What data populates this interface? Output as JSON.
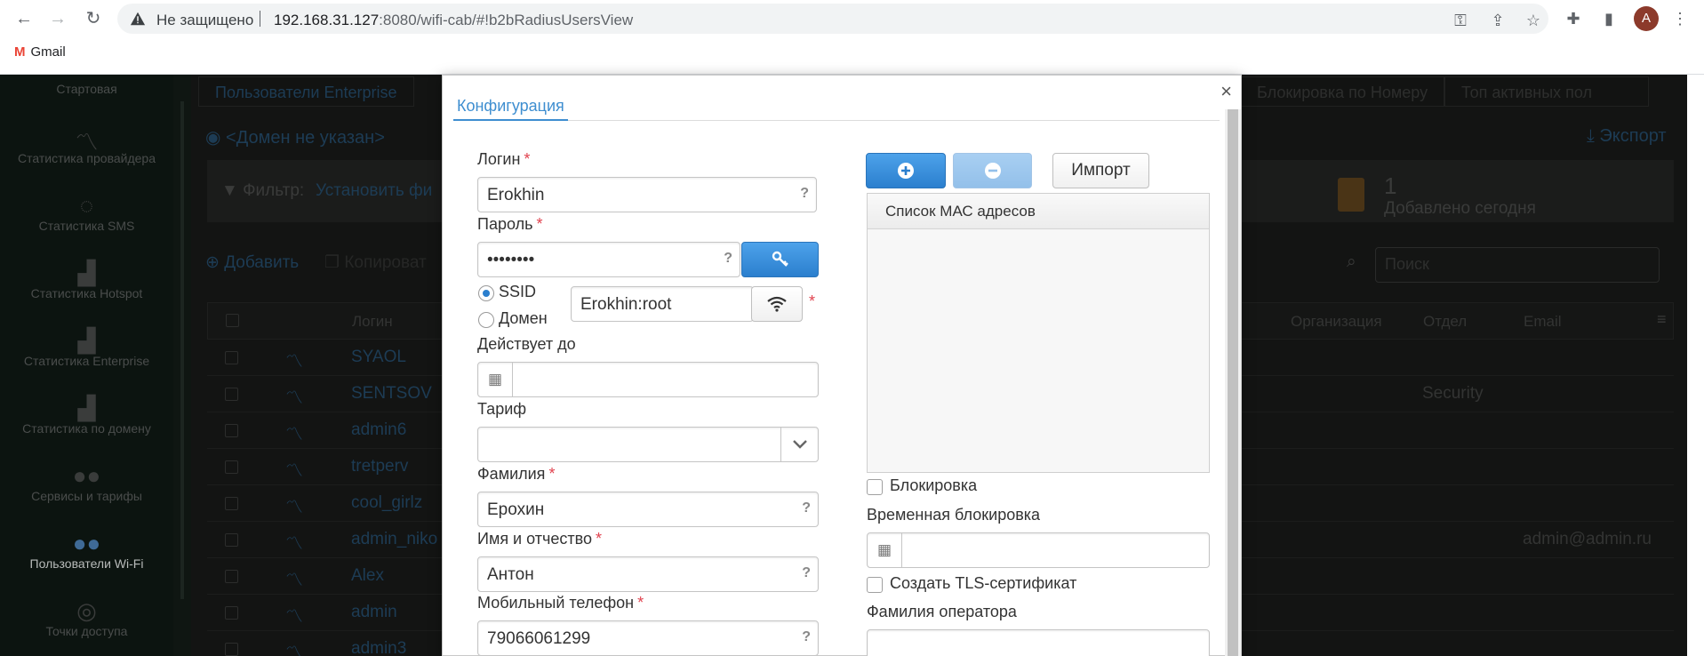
{
  "browser": {
    "security_label": "Не защищено",
    "url_host": "192.168.31.127",
    "url_rest": ":8080/wifi-cab/#!b2bRadiusUsersView",
    "bookmark_gmail": "Gmail",
    "avatar_letter": "A"
  },
  "sidebar": {
    "items": [
      {
        "label": "Стартовая",
        "icon": "home-icon"
      },
      {
        "label": "Статистика провайдера",
        "icon": "chart-line-icon"
      },
      {
        "label": "Статистика SMS",
        "icon": "comment-icon"
      },
      {
        "label": "Статистика Hotspot",
        "icon": "bar-chart-icon"
      },
      {
        "label": "Статистика Enterprise",
        "icon": "bar-chart-icon"
      },
      {
        "label": "Статистика по домену",
        "icon": "bar-chart-icon"
      },
      {
        "label": "Сервисы и тарифы",
        "icon": "users-icon"
      },
      {
        "label": "Пользователи Wi-Fi",
        "icon": "users-icon"
      },
      {
        "label": "Точки доступа",
        "icon": "wifi-icon"
      }
    ]
  },
  "background": {
    "tabs": [
      "Пользователи Enterprise",
      "Блокировка по Номеру",
      "Топ активных пол"
    ],
    "domain": "<Домен не указан>",
    "export": "Экспорт",
    "filter_label": "Фильтр:",
    "filter_value": "Установить фи",
    "stat_count": "1",
    "stat_label": "Добавлено сегодня",
    "add": "Добавить",
    "copy": "Копироват",
    "search_placeholder": "Поиск",
    "columns": [
      "Логин",
      "Организация",
      "Отдел",
      "Email"
    ],
    "rows": [
      {
        "login": "SYAOL",
        "dept": "",
        "email": ""
      },
      {
        "login": "SENTSOV",
        "dept": "Security",
        "email": ""
      },
      {
        "login": "admin6",
        "dept": "",
        "email": ""
      },
      {
        "login": "tretperv",
        "dept": "",
        "email": ""
      },
      {
        "login": "cool_girlz",
        "dept": "",
        "email": ""
      },
      {
        "login": "admin_niko",
        "dept": "",
        "email": "admin@admin.ru"
      },
      {
        "login": "Alex",
        "dept": "",
        "email": ""
      },
      {
        "login": "admin",
        "dept": "",
        "email": ""
      },
      {
        "login": "admin3",
        "dept": "",
        "email": ""
      }
    ]
  },
  "modal": {
    "tab": "Конфигурация",
    "login_label": "Логин",
    "login_value": "Erokhin",
    "password_label": "Пароль",
    "password_value": "••••••••",
    "ssid_label": "SSID",
    "domain_label": "Домен",
    "ssid_value": "Erokhin:root",
    "valid_until_label": "Действует до",
    "tariff_label": "Тариф",
    "lastname_label": "Фамилия",
    "lastname_value": "Ерохин",
    "firstname_label": "Имя и отчество",
    "firstname_value": "Антон",
    "phone_label": "Мобильный телефон",
    "phone_value": "79066061299",
    "import_label": "Импорт",
    "mac_list_header": "Список МАС адресов",
    "block_label": "Блокировка",
    "temp_block_label": "Временная блокировка",
    "tls_label": "Создать TLS-сертификат",
    "operator_lastname_label": "Фамилия оператора",
    "help_mark": "?",
    "required_mark": "*"
  }
}
